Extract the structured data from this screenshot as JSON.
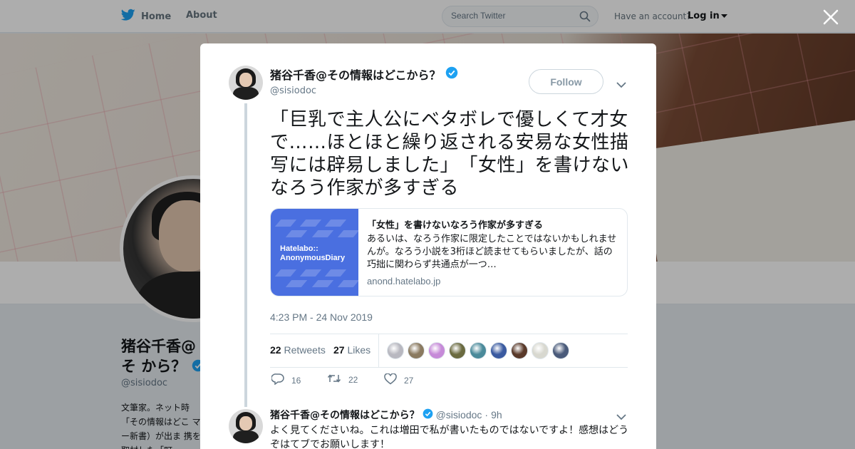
{
  "nav": {
    "home_label": "Home",
    "about_label": "About",
    "search_placeholder": "Search Twitter",
    "have_account": "Have an account?",
    "login_label": "Log in"
  },
  "background_profile": {
    "name": "猪谷千香@その情報はどこから？",
    "name_visible": "猪谷千香@そ から？",
    "handle": "@sisiodoc",
    "bio_visible": "文筆家。ネット時 「その情報はどこ マー新書）が出ま 携を取材した「町"
  },
  "tweet": {
    "author_name": "猪谷千香@その情報はどこから？",
    "author_handle": "@sisiodoc",
    "follow_label": "Follow",
    "text": "「巨乳で主人公にベタボレで優しくて才女で……ほとほと繰り返される安易な女性描写には辟易しました」　「女性」を書けないなろう作家が多すぎる",
    "card": {
      "image_brand": "Hatelabo::\nAnonymousDiary",
      "title": "「女性」を書けないなろう作家が多すぎる",
      "description": "あるいは、なろう作家に限定したことではないかもしれませんが。なろう小説を3桁ほど読ませてもらいましたが、話の巧拙に関わらず共通点が一つ…",
      "domain": "anond.hatelabo.jp"
    },
    "timestamp": "4:23 PM - 24 Nov 2019",
    "retweets_count": "22",
    "retweets_label": "Retweets",
    "likes_count": "27",
    "likes_label": "Likes",
    "liker_colors": [
      "#b8b8c0",
      "#8a7a60",
      "#c68ad8",
      "#6a6a40",
      "#4a8a9a",
      "#3a5aa0",
      "#5a3a2a",
      "#d8d8d0",
      "#4a5a7a"
    ],
    "reply_count": "16",
    "retweet_action_count": "22",
    "like_action_count": "27"
  },
  "reply": {
    "author_name": "猪谷千香@その情報はどこから？",
    "handle": "@sisiodoc",
    "separator": "·",
    "time": "9h",
    "text": "よく見てくださいね。これは増田で私が書いたものではないですよ！感想はどうぞはてブでお願いします！"
  },
  "colors": {
    "twitter_blue": "#1da1f2",
    "verified_blue": "#1da1f2",
    "text_dark": "#14171a",
    "text_gray": "#657786"
  }
}
